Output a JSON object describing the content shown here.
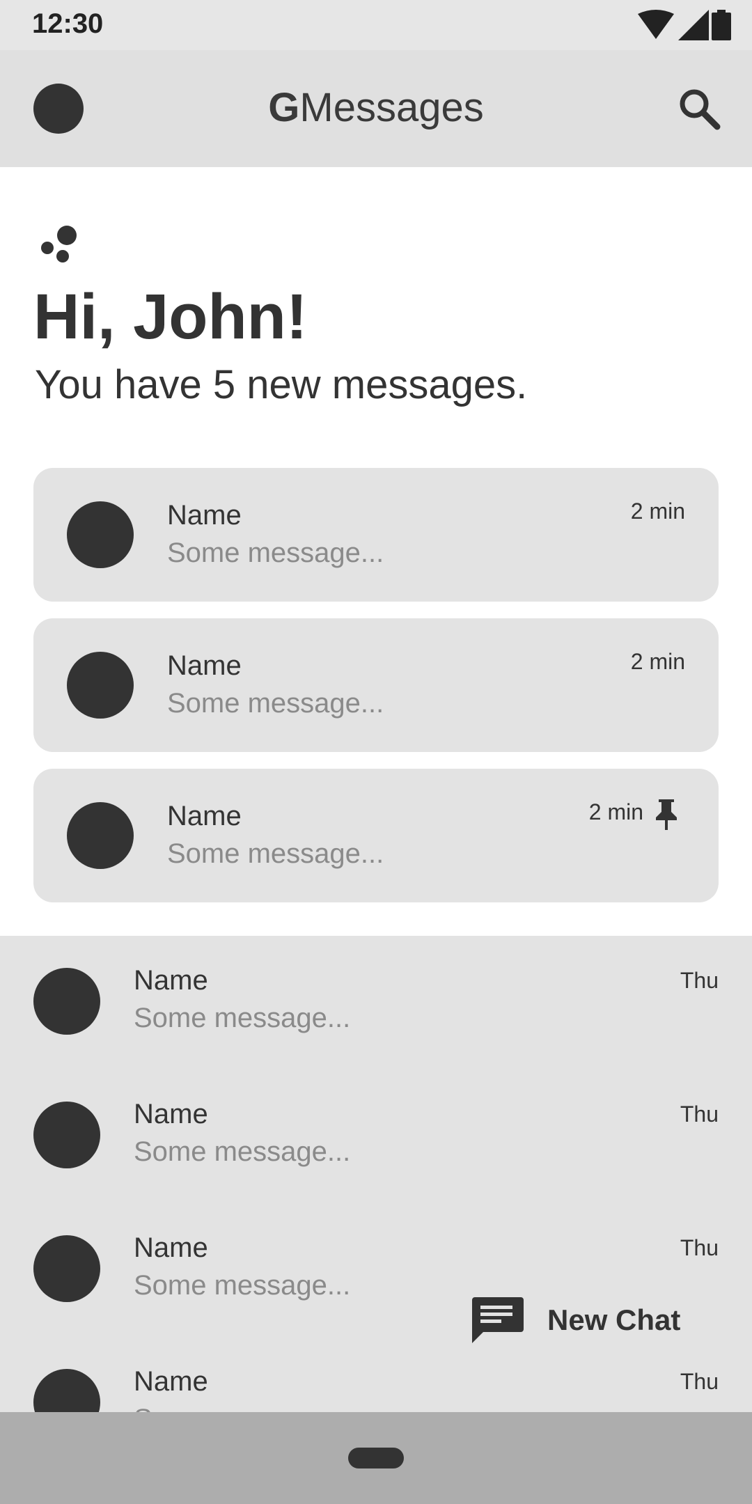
{
  "status_bar": {
    "time": "12:30",
    "icons": [
      "wifi-icon",
      "cell-signal-icon",
      "battery-icon"
    ]
  },
  "app_bar": {
    "title_logo": "G",
    "title_text": "Messages",
    "search_icon": "search-icon",
    "avatar_icon": "avatar"
  },
  "hero": {
    "icon": "assistant-dots-icon",
    "greeting": "Hi, John!",
    "subtitle": "You have 5 new messages."
  },
  "cards": [
    {
      "name": "Name",
      "message": "Some message...",
      "time": "2 min",
      "pinned": false
    },
    {
      "name": "Name",
      "message": "Some message...",
      "time": "2 min",
      "pinned": false
    },
    {
      "name": "Name",
      "message": "Some message...",
      "time": "2 min",
      "pinned": true
    }
  ],
  "list": [
    {
      "name": "Name",
      "message": "Some message...",
      "time": "Thu"
    },
    {
      "name": "Name",
      "message": "Some message...",
      "time": "Thu"
    },
    {
      "name": "Name",
      "message": "Some message...",
      "time": "Thu"
    },
    {
      "name": "Name",
      "message": "Some message...",
      "time": "Thu"
    }
  ],
  "fab": {
    "label": "New Chat",
    "icon": "chat-icon"
  },
  "colors": {
    "dark": "#333333",
    "muted_text": "#8a8a8a",
    "card_bg": "#e3e3e3",
    "nav_bg": "#adadad"
  }
}
